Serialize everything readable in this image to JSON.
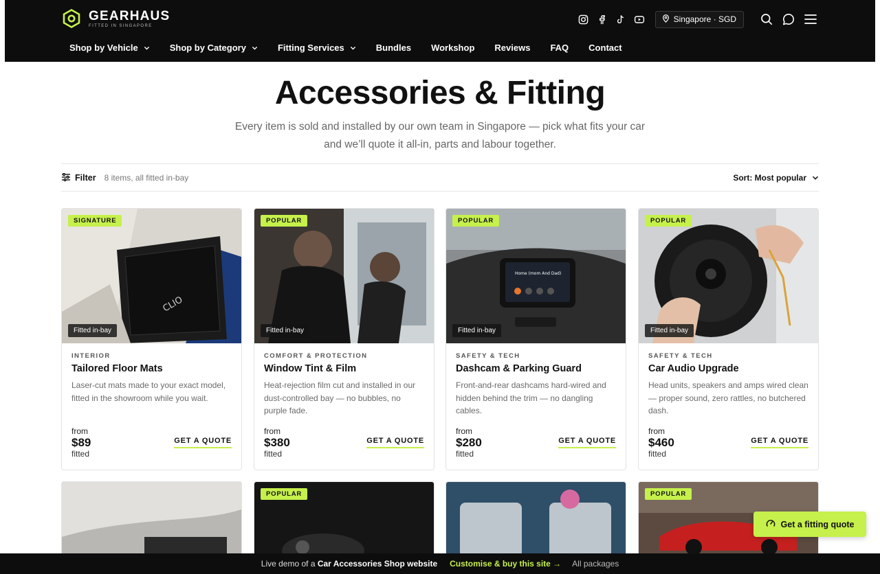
{
  "brand": {
    "name": "GEARHAUS",
    "tagline": "FITTED IN SINGAPORE"
  },
  "header": {
    "region": "Singapore · SGD",
    "social": [
      "instagram-icon",
      "facebook-icon",
      "tiktok-icon",
      "youtube-icon"
    ]
  },
  "nav": [
    {
      "label": "Shop by Vehicle",
      "dropdown": true
    },
    {
      "label": "Shop by Category",
      "dropdown": true
    },
    {
      "label": "Fitting Services",
      "dropdown": true
    },
    {
      "label": "Bundles",
      "dropdown": false
    },
    {
      "label": "Workshop",
      "dropdown": false
    },
    {
      "label": "Reviews",
      "dropdown": false
    },
    {
      "label": "FAQ",
      "dropdown": false
    },
    {
      "label": "Contact",
      "dropdown": false
    }
  ],
  "hero": {
    "title": "Accessories & Fitting",
    "subtitle": "Every item is sold and installed by our own team in Singapore — pick what fits your car and we’ll quote it all-in, parts and labour together."
  },
  "toolbar": {
    "filter_label": "Filter",
    "count": "8 items, all fitted in-bay",
    "sort_label": "Sort: Most popular"
  },
  "products": [
    {
      "badge": "SIGNATURE",
      "fitted": "Fitted in-bay",
      "category": "INTERIOR",
      "title": "Tailored Floor Mats",
      "desc": "Laser-cut mats made to your exact model, fitted in the showroom while you wait.",
      "from": "from",
      "price": "$89",
      "unit": "fitted",
      "cta": "GET A QUOTE"
    },
    {
      "badge": "POPULAR",
      "fitted": "Fitted in-bay",
      "category": "COMFORT & PROTECTION",
      "title": "Window Tint & Film",
      "desc": "Heat-rejection film cut and installed in our dust-controlled bay — no bubbles, no purple fade.",
      "from": "from",
      "price": "$380",
      "unit": "fitted",
      "cta": "GET A QUOTE"
    },
    {
      "badge": "POPULAR",
      "fitted": "Fitted in-bay",
      "category": "SAFETY & TECH",
      "title": "Dashcam & Parking Guard",
      "desc": "Front-and-rear dashcams hard-wired and hidden behind the trim — no dangling cables.",
      "from": "from",
      "price": "$280",
      "unit": "fitted",
      "cta": "GET A QUOTE"
    },
    {
      "badge": "POPULAR",
      "fitted": "Fitted in-bay",
      "category": "SAFETY & TECH",
      "title": "Car Audio Upgrade",
      "desc": "Head units, speakers and amps wired clean — proper sound, zero rattles, no butchered dash.",
      "from": "from",
      "price": "$460",
      "unit": "fitted",
      "cta": "GET A QUOTE"
    }
  ],
  "products_row2": [
    {
      "badge": ""
    },
    {
      "badge": "POPULAR"
    },
    {
      "badge": ""
    },
    {
      "badge": "POPULAR"
    }
  ],
  "fab": {
    "label": "Get a fitting quote"
  },
  "demo_bar": {
    "prefix": "Live demo of a",
    "site": "Car Accessories Shop website",
    "cta": "Customise & buy this site →",
    "all": "All packages"
  },
  "colors": {
    "accent": "#c6f04b",
    "header_bg": "#0d0d0d"
  }
}
